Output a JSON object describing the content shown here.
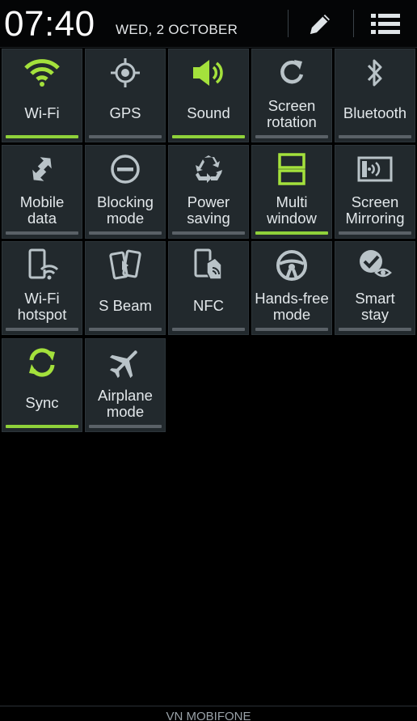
{
  "status": {
    "time": "07:40",
    "date": "WED, 2 OCTOBER"
  },
  "colors": {
    "active": "#a4e13c",
    "inactive": "#b9c3c8",
    "bar_on": "#8fd13a",
    "bar_off": "#5a6167"
  },
  "tiles": [
    {
      "label": "Wi-Fi",
      "icon": "wifi-icon",
      "active": true
    },
    {
      "label": "GPS",
      "icon": "gps-icon",
      "active": false
    },
    {
      "label": "Sound",
      "icon": "sound-icon",
      "active": true
    },
    {
      "label": "Screen rotation",
      "icon": "rotation-icon",
      "active": false
    },
    {
      "label": "Bluetooth",
      "icon": "bluetooth-icon",
      "active": false
    },
    {
      "label": "Mobile data",
      "icon": "mobile-data-icon",
      "active": false
    },
    {
      "label": "Blocking mode",
      "icon": "blocking-mode-icon",
      "active": false
    },
    {
      "label": "Power saving",
      "icon": "recycle-icon",
      "active": false
    },
    {
      "label": "Multi window",
      "icon": "multi-window-icon",
      "active": true
    },
    {
      "label": "Screen Mirroring",
      "icon": "screen-mirroring-icon",
      "active": false
    },
    {
      "label": "Wi-Fi hotspot",
      "icon": "wifi-hotspot-icon",
      "active": false
    },
    {
      "label": "S Beam",
      "icon": "s-beam-icon",
      "active": false
    },
    {
      "label": "NFC",
      "icon": "nfc-icon",
      "active": false
    },
    {
      "label": "Hands-free mode",
      "icon": "steering-wheel-icon",
      "active": false
    },
    {
      "label": "Smart stay",
      "icon": "smart-stay-icon",
      "active": false
    },
    {
      "label": "Sync",
      "icon": "sync-icon",
      "active": true
    },
    {
      "label": "Airplane mode",
      "icon": "airplane-icon",
      "active": false
    }
  ],
  "footer": {
    "carrier": "VN MOBIFONE"
  }
}
